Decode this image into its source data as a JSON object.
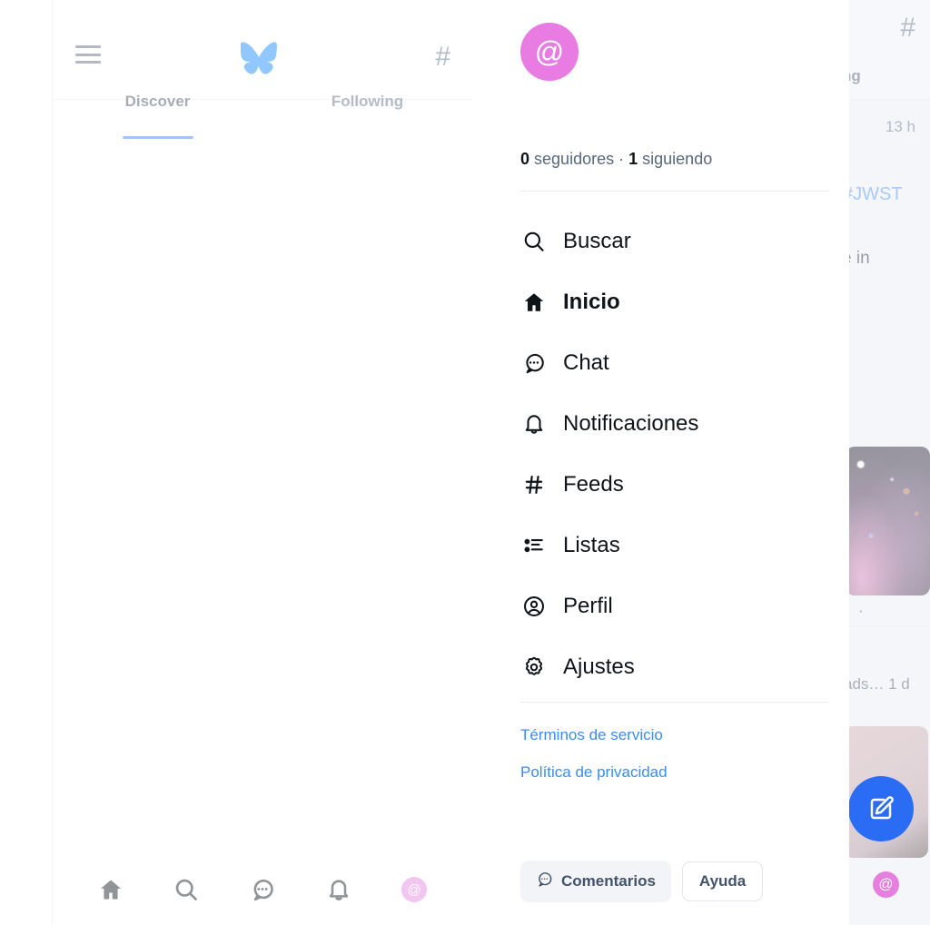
{
  "app": {
    "accent_blue": "#2f80ed",
    "link_blue": "#3b8cf5",
    "avatar_pink": "#e87ce3",
    "feed_bg": "#e7eaf1",
    "text_dark": "#0f1419",
    "text_muted": "#59677d"
  },
  "main": {
    "header": {
      "menu_icon": "hamburger-icon",
      "logo_icon": "bluesky-butterfly-logo",
      "feeds_icon": "hash-icon"
    },
    "tabs": [
      {
        "label": "Discover",
        "active": true
      },
      {
        "label": "Following",
        "active": false
      }
    ],
    "bottom_nav": [
      {
        "icon": "home-icon",
        "label": "Inicio",
        "active": true
      },
      {
        "icon": "search-icon",
        "label": "Buscar",
        "active": false
      },
      {
        "icon": "chat-icon",
        "label": "Chat",
        "active": false
      },
      {
        "icon": "bell-icon",
        "label": "Notificaciones",
        "active": false
      },
      {
        "icon": "avatar-icon",
        "label": "Perfil",
        "active": false,
        "avatar_char": "@"
      }
    ]
  },
  "drawer": {
    "avatar_char": "@",
    "display_name": "",
    "stats": {
      "followers_count": "0",
      "followers_label": "seguidores",
      "separator": "·",
      "following_count": "1",
      "following_label": "siguiendo"
    },
    "menu": [
      {
        "icon": "search-icon",
        "label": "Buscar",
        "active": false
      },
      {
        "icon": "home-icon",
        "label": "Inicio",
        "active": true
      },
      {
        "icon": "chat-icon",
        "label": "Chat",
        "active": false
      },
      {
        "icon": "bell-icon",
        "label": "Notificaciones",
        "active": false
      },
      {
        "icon": "hash-icon",
        "label": "Feeds",
        "active": false
      },
      {
        "icon": "list-icon",
        "label": "Listas",
        "active": false
      },
      {
        "icon": "user-circle-icon",
        "label": "Perfil",
        "active": false
      },
      {
        "icon": "gear-icon",
        "label": "Ajustes",
        "active": false
      }
    ],
    "legal": [
      {
        "label": "Términos de servicio"
      },
      {
        "label": "Política de privacidad"
      }
    ],
    "footer": {
      "feedback_label": "Comentarios",
      "feedback_icon": "chat-bubble-icon",
      "help_label": "Ayuda"
    }
  },
  "feed_column": {
    "hash_icon": "hash-icon",
    "tab_text_fragment": "ng",
    "timestamp": "13 h",
    "hashtag_fragment": "#JWST",
    "body_fragment": "e in",
    "post_dots": "· ·",
    "meta_fragment": "ads… 1 d",
    "compose_icon": "compose-icon",
    "avatar_char": "@"
  }
}
